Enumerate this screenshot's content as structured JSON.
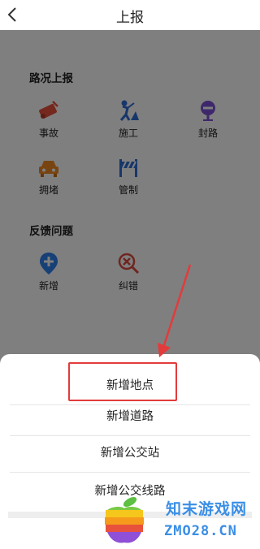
{
  "header": {
    "title": "上报",
    "back_icon": "chevron-left-icon"
  },
  "road_report": {
    "title": "路况上报",
    "items": [
      {
        "label": "事故",
        "icon": "accident-icon",
        "color": "#e8513c"
      },
      {
        "label": "施工",
        "icon": "construction-icon",
        "color": "#2f6fd6"
      },
      {
        "label": "封路",
        "icon": "road-closed-icon",
        "color": "#7b50d8"
      },
      {
        "label": "拥堵",
        "icon": "traffic-jam-icon",
        "color": "#f08a24"
      },
      {
        "label": "管制",
        "icon": "traffic-control-icon",
        "color": "#2f6fd6"
      }
    ]
  },
  "feedback": {
    "title": "反馈问题",
    "items": [
      {
        "label": "新增",
        "icon": "add-location-icon",
        "color": "#2f80ed"
      },
      {
        "label": "纠错",
        "icon": "error-correction-icon",
        "color": "#e04a3f"
      }
    ]
  },
  "sheet": {
    "items": [
      {
        "label": "新增地点"
      },
      {
        "label": "新增道路"
      },
      {
        "label": "新增公交站"
      },
      {
        "label": "新增公交线路"
      }
    ],
    "highlight_color": "#e33b3b"
  },
  "watermark": {
    "name": "知末游戏网",
    "domain": "ZMO28.CN",
    "color": "#3a8ee6"
  }
}
